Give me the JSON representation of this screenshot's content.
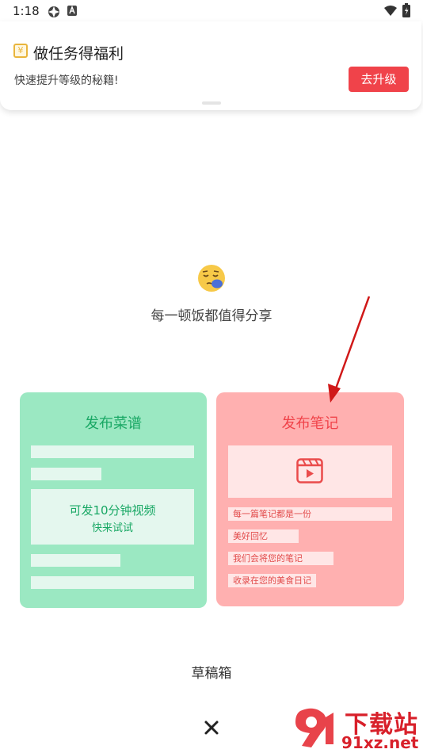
{
  "status_bar": {
    "time": "1:18"
  },
  "notification": {
    "title": "做任务得福利",
    "coin_symbol": "¥",
    "subtitle": "快速提升等级的秘籍!",
    "button_label": "去升级"
  },
  "main": {
    "tagline": "每一顿饭都值得分享",
    "recipe_card": {
      "title": "发布菜谱",
      "video_line1": "可发10分钟视频",
      "video_line2": "快来试试"
    },
    "note_card": {
      "title": "发布笔记",
      "lines": [
        "每一篇笔记都是一份",
        "美好回忆",
        "我们会将您的笔记",
        "收录在您的美食日记"
      ]
    },
    "drafts_label": "草稿箱"
  },
  "watermark": {
    "text_top": "下载站",
    "text_bottom": "91xz.net"
  },
  "colors": {
    "accent_red": "#f0434a",
    "accent_green": "#1aa865"
  }
}
